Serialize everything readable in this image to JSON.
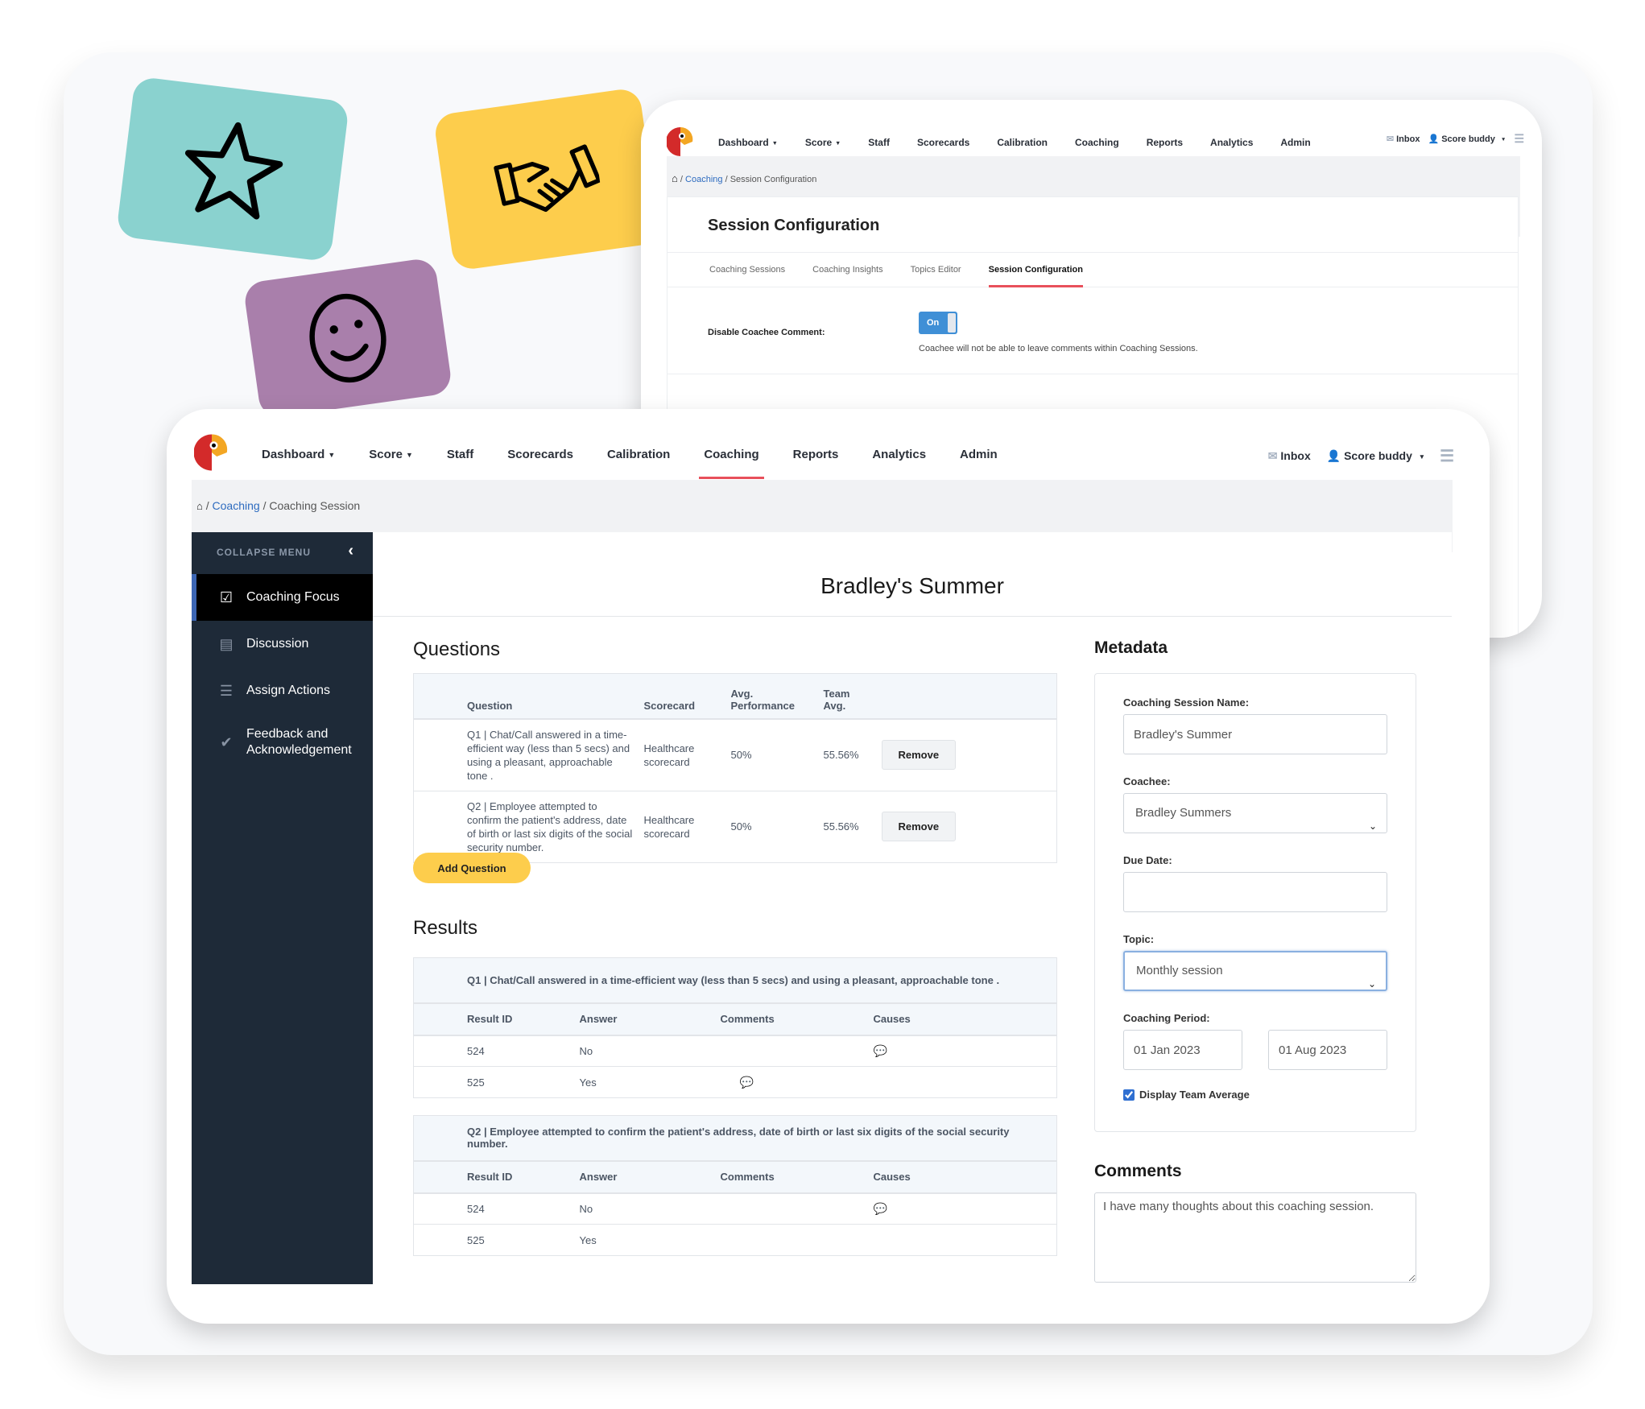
{
  "decor": {
    "cards": [
      {
        "icon": "star-icon",
        "color": "#8ad2cf"
      },
      {
        "icon": "handshake-icon",
        "color": "#fdcd4c"
      },
      {
        "icon": "smiley-icon",
        "color": "#a97fab"
      }
    ]
  },
  "nav": {
    "items": [
      {
        "label": "Dashboard",
        "caret": true
      },
      {
        "label": "Score",
        "caret": true
      },
      {
        "label": "Staff"
      },
      {
        "label": "Scorecards"
      },
      {
        "label": "Calibration"
      },
      {
        "label": "Coaching",
        "active": true
      },
      {
        "label": "Reports"
      },
      {
        "label": "Analytics"
      },
      {
        "label": "Admin"
      }
    ],
    "inbox": "Inbox",
    "user": "Score buddy",
    "caret": "▼",
    "accent": "#e8505b"
  },
  "back_window": {
    "breadcrumb": {
      "link": "Coaching",
      "sep": "/",
      "current": "Session Configuration"
    },
    "title": "Session Configuration",
    "tabs": [
      "Coaching Sessions",
      "Coaching Insights",
      "Topics Editor",
      "Session Configuration"
    ],
    "active_tab": "Session Configuration",
    "setting": {
      "label": "Disable Coachee Comment:",
      "toggle": "On",
      "help": "Coachee will not be able to leave comments within Coaching Sessions."
    }
  },
  "front_window": {
    "breadcrumb": {
      "link": "Coaching",
      "sep": "/",
      "current": "Coaching Session"
    },
    "sidebar": {
      "collapse": "COLLAPSE MENU",
      "items": [
        {
          "label": "Coaching Focus",
          "icon": "clipboard-check-icon",
          "active": true
        },
        {
          "label": "Discussion",
          "icon": "chat-icon"
        },
        {
          "label": "Assign Actions",
          "icon": "list-icon"
        },
        {
          "label": "Feedback and Acknowledgement",
          "icon": "check-icon"
        }
      ]
    },
    "title": "Bradley's Summer",
    "questions": {
      "heading": "Questions",
      "columns": [
        "Question",
        "Scorecard",
        "Avg. Performance",
        "Team Avg.",
        ""
      ],
      "rows": [
        {
          "question": "Q1 | Chat/Call answered in a time-efficient way (less than 5 secs) and using a pleasant, approachable tone .",
          "scorecard": "Healthcare scorecard",
          "avg": "50%",
          "team": "55.56%",
          "action": "Remove"
        },
        {
          "question": "Q2 | Employee attempted to confirm the patient's address, date of birth or last six digits of the social security number.",
          "scorecard": "Healthcare scorecard",
          "avg": "50%",
          "team": "55.56%",
          "action": "Remove"
        }
      ],
      "add_label": "Add Question"
    },
    "results": {
      "heading": "Results",
      "columns": [
        "Result ID",
        "Answer",
        "Comments",
        "Causes"
      ],
      "groups": [
        {
          "question": "Q1 | Chat/Call answered in a time-efficient way (less than 5 secs) and using a pleasant, approachable tone .",
          "rows": [
            {
              "id": "524",
              "answer": "No",
              "comment_icon": false,
              "cause_icon": true
            },
            {
              "id": "525",
              "answer": "Yes",
              "comment_icon": true,
              "cause_icon": false
            }
          ]
        },
        {
          "question": "Q2 | Employee attempted to confirm the patient's address, date of birth or last six digits of the social security number.",
          "rows": [
            {
              "id": "524",
              "answer": "No",
              "comment_icon": false,
              "cause_icon": true
            },
            {
              "id": "525",
              "answer": "Yes",
              "comment_icon": false,
              "cause_icon": false
            }
          ]
        }
      ]
    },
    "metadata": {
      "heading": "Metadata",
      "session_name_label": "Coaching Session Name:",
      "session_name": "Bradley's Summer",
      "coachee_label": "Coachee:",
      "coachee": "Bradley Summers",
      "due_label": "Due Date:",
      "due": "",
      "topic_label": "Topic:",
      "topic": "Monthly session",
      "period_label": "Coaching Period:",
      "period_start": "01 Jan 2023",
      "period_end": "01 Aug 2023",
      "team_avg_label": "Display Team Average",
      "team_avg_checked": true
    },
    "comments": {
      "heading": "Comments",
      "text": "I have many thoughts about this coaching session."
    }
  }
}
